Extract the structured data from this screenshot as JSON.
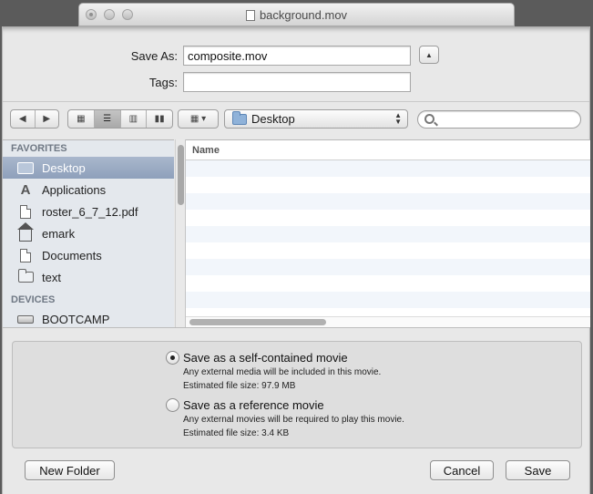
{
  "background_window": {
    "title": "background.mov"
  },
  "save_sheet": {
    "save_as_label": "Save As:",
    "save_as_value": "composite.mov",
    "tags_label": "Tags:",
    "tags_value": ""
  },
  "toolbar": {
    "location": "Desktop",
    "search_placeholder": ""
  },
  "sidebar": {
    "favorites_heading": "FAVORITES",
    "items": [
      {
        "label": "Desktop",
        "icon": "desktop-icon",
        "selected": true
      },
      {
        "label": "Applications",
        "icon": "applications-icon"
      },
      {
        "label": "roster_6_7_12.pdf",
        "icon": "document-icon"
      },
      {
        "label": "emark",
        "icon": "home-icon"
      },
      {
        "label": "Documents",
        "icon": "documents-folder-icon"
      },
      {
        "label": "text",
        "icon": "folder-icon"
      }
    ],
    "devices_heading": "DEVICES",
    "devices": [
      {
        "label": "BOOTCAMP",
        "icon": "drive-icon"
      }
    ]
  },
  "file_list": {
    "name_column": "Name"
  },
  "options": {
    "self_contained": {
      "label": "Save as a self-contained movie",
      "line1": "Any external media will be included in this movie.",
      "line2": "Estimated file size:  97.9 MB",
      "selected": true
    },
    "reference": {
      "label": "Save as a reference movie",
      "line1": "Any external movies will be required to play this movie.",
      "line2": "Estimated file size:  3.4 KB",
      "selected": false
    }
  },
  "buttons": {
    "new_folder": "New Folder",
    "cancel": "Cancel",
    "save": "Save"
  }
}
